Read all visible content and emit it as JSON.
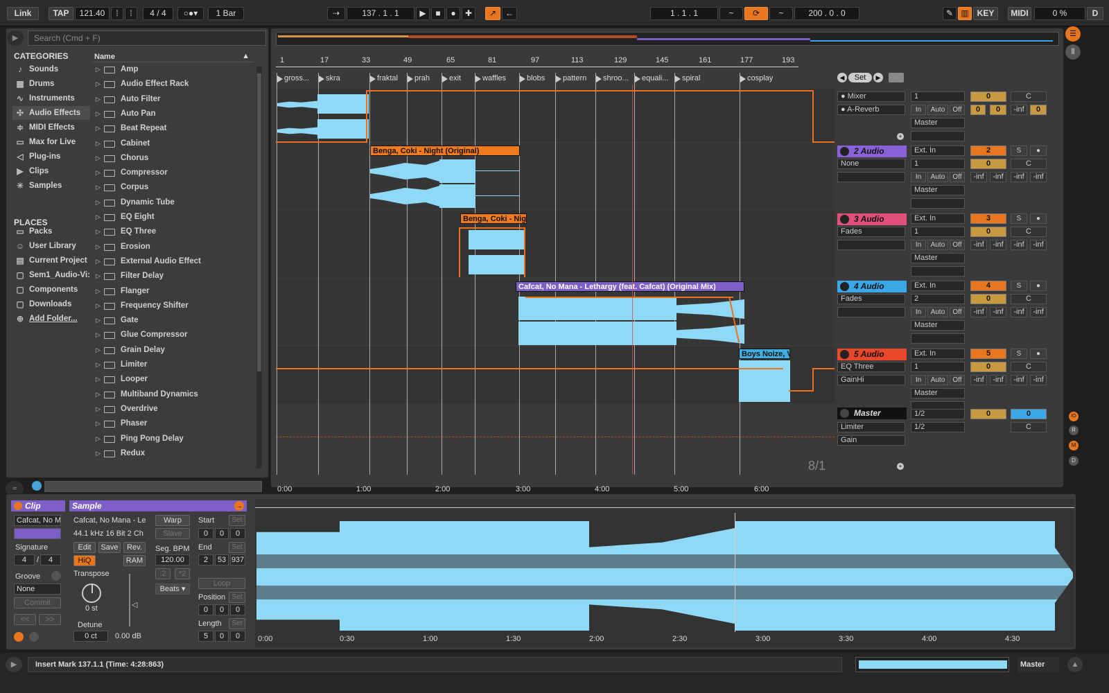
{
  "topbar": {
    "link": "Link",
    "tap": "TAP",
    "tempo": "121.40",
    "sig_num": "4",
    "sig_sep": "/",
    "sig_den": "4",
    "quantize": "1 Bar",
    "position": "137 .  1 .  1",
    "loop_start": "1 .  1 .  1",
    "loop_length": "200 .  0 .  0",
    "key": "KEY",
    "midi": "MIDI",
    "cpu": "0 %",
    "d": "D"
  },
  "browser": {
    "search_placeholder": "Search (Cmd + F)",
    "categories_title": "CATEGORIES",
    "categories": [
      {
        "label": "Sounds",
        "icon": "note-icon"
      },
      {
        "label": "Drums",
        "icon": "grid-icon"
      },
      {
        "label": "Instruments",
        "icon": "wave-icon"
      },
      {
        "label": "Audio Effects",
        "icon": "fx-icon"
      },
      {
        "label": "MIDI Effects",
        "icon": "midi-fx-icon"
      },
      {
        "label": "Max for Live",
        "icon": "max-icon"
      },
      {
        "label": "Plug-ins",
        "icon": "plug-icon"
      },
      {
        "label": "Clips",
        "icon": "clip-icon"
      },
      {
        "label": "Samples",
        "icon": "sample-icon"
      }
    ],
    "places_title": "PLACES",
    "places": [
      "Packs",
      "User Library",
      "Current Project",
      "Sem1_Audio-Vi:",
      "Components",
      "Downloads",
      "Add Folder..."
    ],
    "column_name": "Name",
    "items": [
      "Amp",
      "Audio Effect Rack",
      "Auto Filter",
      "Auto Pan",
      "Beat Repeat",
      "Cabinet",
      "Chorus",
      "Compressor",
      "Corpus",
      "Dynamic Tube",
      "EQ Eight",
      "EQ Three",
      "Erosion",
      "External Audio Effect",
      "Filter Delay",
      "Flanger",
      "Frequency Shifter",
      "Gate",
      "Glue Compressor",
      "Grain Delay",
      "Limiter",
      "Looper",
      "Multiband Dynamics",
      "Overdrive",
      "Phaser",
      "Ping Pong Delay",
      "Redux"
    ]
  },
  "arrangement": {
    "ruler": [
      "1",
      "17",
      "33",
      "49",
      "65",
      "81",
      "97",
      "113",
      "129",
      "145",
      "161",
      "177",
      "193"
    ],
    "locators": [
      "gross...",
      "skra",
      "fraktal",
      "prah",
      "exit",
      "waffles",
      "blobs",
      "pattern",
      "shroo...",
      "equali...",
      "spiral",
      "cosplay"
    ],
    "times": [
      "0:00",
      "1:00",
      "2:00",
      "3:00",
      "4:00",
      "5:00",
      "6:00"
    ],
    "zoom": "8/1",
    "set_label": "Set",
    "clips": [
      {
        "name": "Benga, Coki - Night (Original)",
        "color": "#f07a1e"
      },
      {
        "name": "Benga, Coki - Nigh",
        "color": "#f07a1e"
      },
      {
        "name": "Cafcat, No Mana - Lethargy (feat. Cafcat) (Original Mix)",
        "color": "#7e5fc8"
      },
      {
        "name": "Boys Noize, V",
        "color": "#41aee0"
      }
    ]
  },
  "mixer": {
    "track1": {
      "dev1": "Mixer",
      "dev2": "A-Reverb",
      "input": "1",
      "out": "Master",
      "vol": "0",
      "pan": "C",
      "sends": [
        "0",
        "0",
        "-inf",
        "0"
      ]
    },
    "tracks": [
      {
        "name": "2 Audio",
        "color": "#8a62d8",
        "input": "Ext. In",
        "sub": "None",
        "ch": "1",
        "num": "2",
        "vol": "0",
        "out": "Master"
      },
      {
        "name": "3 Audio",
        "color": "#e0507a",
        "input": "Ext. In",
        "sub": "Fades",
        "ch": "1",
        "num": "3",
        "vol": "0",
        "out": "Master"
      },
      {
        "name": "4 Audio",
        "color": "#3aa8e8",
        "input": "Ext. In",
        "sub": "Fades",
        "ch": "2",
        "num": "4",
        "vol": "0",
        "out": "Master"
      },
      {
        "name": "5 Audio",
        "color": "#e8472a",
        "input": "Ext. In",
        "sub": "EQ Three",
        "sub2": "GainHi",
        "ch": "1",
        "num": "5",
        "vol": "0",
        "out": "Master"
      }
    ],
    "master": {
      "name": "Master",
      "dev1": "Limiter",
      "dev2": "Gain",
      "cue1": "1/2",
      "cue2": "1/2",
      "vol": "0",
      "vol2": "0",
      "pan": "C"
    },
    "in": "In",
    "auto": "Auto",
    "off": "Off",
    "inf": "-inf",
    "s": "S",
    "c": "C"
  },
  "clip_view": {
    "clip_title": "Clip",
    "clip_name": "Cafcat, No M",
    "signature_label": "Signature",
    "sig_num": "4",
    "sig_den": "4",
    "groove_label": "Groove",
    "groove": "None",
    "commit": "Commit",
    "sample_title": "Sample",
    "sample_name": "Cafcat, No Mana - Le",
    "sample_info": "44.1 kHz 16 Bit 2 Ch",
    "edit": "Edit",
    "save": "Save",
    "rev": "Rev.",
    "hiq": "HiQ",
    "ram": "RAM",
    "transpose_label": "Transpose",
    "transpose": "0 st",
    "detune_label": "Detune",
    "detune": "0 ct",
    "gain": "0.00 dB",
    "warp": "Warp",
    "slave": "Slave",
    "seg_bpm_label": "Seg. BPM",
    "seg_bpm": "120.00",
    "mode": "Beats",
    "start_label": "Start",
    "start": [
      "0",
      "0",
      "0"
    ],
    "end_label": "End",
    "end": [
      "2",
      "53",
      "937"
    ],
    "loop": "Loop",
    "position_label": "Position",
    "position": [
      "0",
      "0",
      "0"
    ],
    "length_label": "Length",
    "length": [
      "5",
      "0",
      "0"
    ],
    "set": "Set",
    "times": [
      "0:00",
      "0:30",
      "1:00",
      "1:30",
      "2:00",
      "2:30",
      "3:00",
      "3:30",
      "4:00",
      "4:30"
    ]
  },
  "status": {
    "text": "Insert Mark 137.1.1 (Time: 4:28:863)",
    "master": "Master"
  }
}
